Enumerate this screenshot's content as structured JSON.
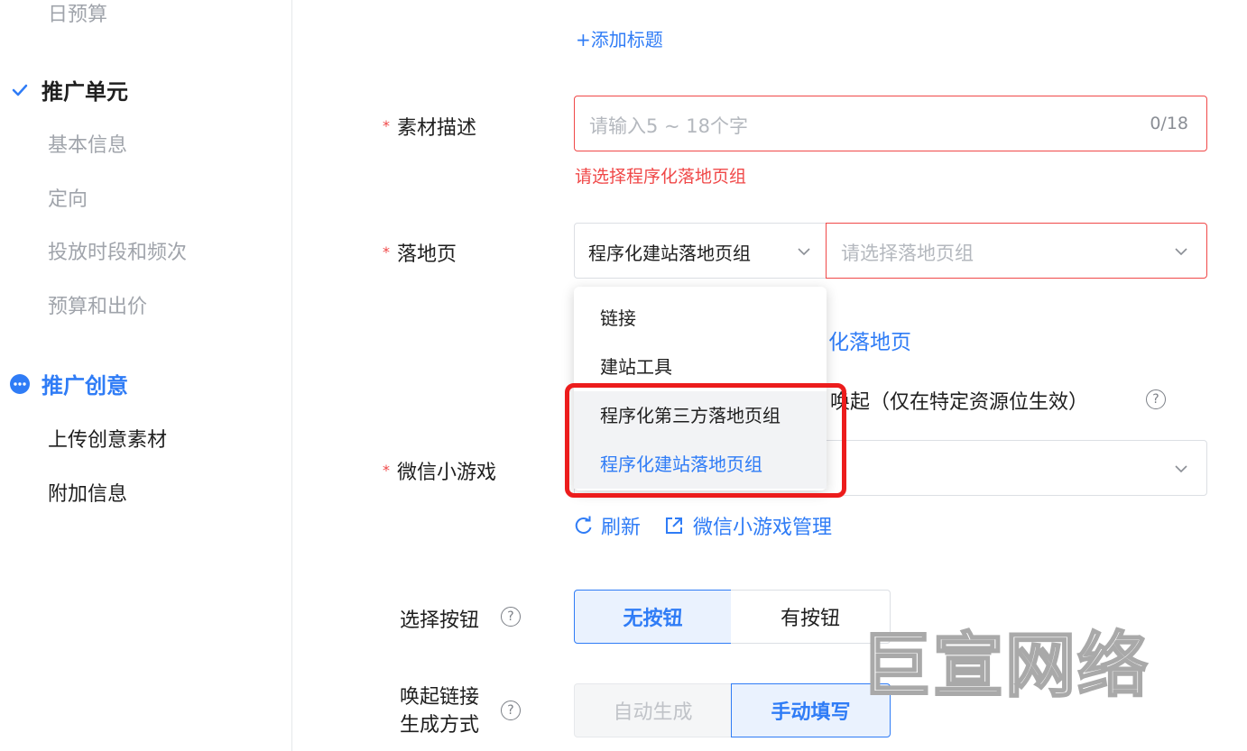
{
  "sidebar": {
    "daily_budget": "日预算",
    "unit_section": "推广单元",
    "unit_items": [
      "基本信息",
      "定向",
      "投放时段和频次",
      "预算和出价"
    ],
    "creative_section": "推广创意",
    "creative_items": [
      "上传创意素材",
      "附加信息"
    ]
  },
  "form": {
    "add_title_link": "+添加标题",
    "material_desc": {
      "label": "素材描述",
      "placeholder": "请输入5 ~ 18个字",
      "counter": "0/18",
      "error": "请选择程序化落地页组"
    },
    "landing_page": {
      "label": "落地页",
      "type_value": "程序化建站落地页组",
      "group_placeholder": "请选择落地页组",
      "behind_text": "化落地页",
      "options": [
        "链接",
        "建站工具",
        "程序化第三方落地页组",
        "程序化建站落地页组"
      ]
    },
    "deeplink_text": "唤起（仅在特定资源位生效）",
    "mini_game": {
      "label": "微信小游戏",
      "refresh": "刷新",
      "manage": "微信小游戏管理"
    },
    "choose_button": {
      "label": "选择按钮",
      "options": [
        "无按钮",
        "有按钮"
      ]
    },
    "deeplink_method": {
      "label_line1": "唤起链接",
      "label_line2": "生成方式",
      "options": [
        "自动生成",
        "手动填写"
      ]
    }
  },
  "watermark": "巨宣网络",
  "colors": {
    "accent": "#2f7cf6",
    "error": "#f04848",
    "highlight": "#ec1c1c"
  }
}
